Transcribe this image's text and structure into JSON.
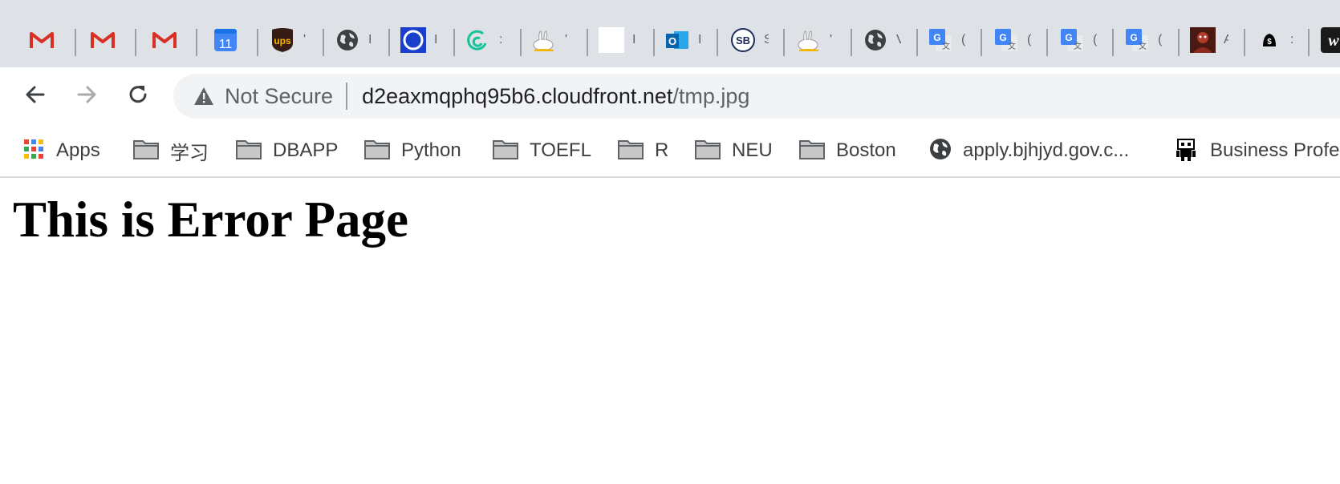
{
  "tabs": [
    {
      "icon": "gmail-icon",
      "fragment": ""
    },
    {
      "icon": "gmail-icon",
      "fragment": ""
    },
    {
      "icon": "gmail-icon",
      "fragment": ""
    },
    {
      "icon": "calendar-icon",
      "fragment": "",
      "calendar_day": "11"
    },
    {
      "icon": "ups-icon",
      "fragment": "'",
      "ups_text": "ups"
    },
    {
      "icon": "globe-icon",
      "fragment": "I"
    },
    {
      "icon": "blue-circle-icon",
      "fragment": "I"
    },
    {
      "icon": "grammarly-icon",
      "fragment": ":"
    },
    {
      "icon": "rabbit-icon",
      "fragment": "'"
    },
    {
      "icon": "blank-page-icon",
      "fragment": "I"
    },
    {
      "icon": "outlook-icon",
      "fragment": "I"
    },
    {
      "icon": "sb-icon",
      "fragment": "S",
      "sb_text": "SB"
    },
    {
      "icon": "rabbit-icon",
      "fragment": "'"
    },
    {
      "icon": "globe-icon",
      "fragment": "V"
    },
    {
      "icon": "google-translate-icon",
      "fragment": "("
    },
    {
      "icon": "google-translate-icon",
      "fragment": "("
    },
    {
      "icon": "google-translate-icon",
      "fragment": "("
    },
    {
      "icon": "google-translate-icon",
      "fragment": "("
    },
    {
      "icon": "game-thumbnail-icon",
      "fragment": "A"
    },
    {
      "icon": "dollar-circle-icon",
      "fragment": ":"
    },
    {
      "icon": "w-logo-icon",
      "fragment": "",
      "w_text": "w"
    }
  ],
  "colors": {
    "tabstrip_bg": "#dee1e6",
    "gmail_red": "#d93025",
    "calendar_blue": "#4285f4",
    "ups_brown": "#351c15",
    "ups_gold": "#ffb500",
    "outlook_blue": "#0a64ad",
    "translate_blue": "#4285f4"
  },
  "toolbar": {
    "back_icon": "back-arrow-icon",
    "forward_icon": "forward-arrow-icon",
    "reload_icon": "reload-icon",
    "security_label": "Not Secure",
    "url_host": "d2eaxmqphq95b6.cloudfront.net",
    "url_path": "/tmp.jpg"
  },
  "bookmarks": [
    {
      "icon": "apps-grid-icon",
      "label": "Apps"
    },
    {
      "icon": "folder-icon",
      "label": "学习"
    },
    {
      "icon": "folder-icon",
      "label": "DBAPP"
    },
    {
      "icon": "folder-icon",
      "label": "Python"
    },
    {
      "icon": "folder-icon",
      "label": "TOEFL"
    },
    {
      "icon": "folder-icon",
      "label": "R"
    },
    {
      "icon": "folder-icon",
      "label": "NEU"
    },
    {
      "icon": "folder-icon",
      "label": "Boston"
    },
    {
      "icon": "globe-icon",
      "label": "apply.bjhjyd.gov.c..."
    },
    {
      "icon": "robot-icon",
      "label": "Business Profe"
    }
  ],
  "page": {
    "heading": "This is Error Page"
  }
}
